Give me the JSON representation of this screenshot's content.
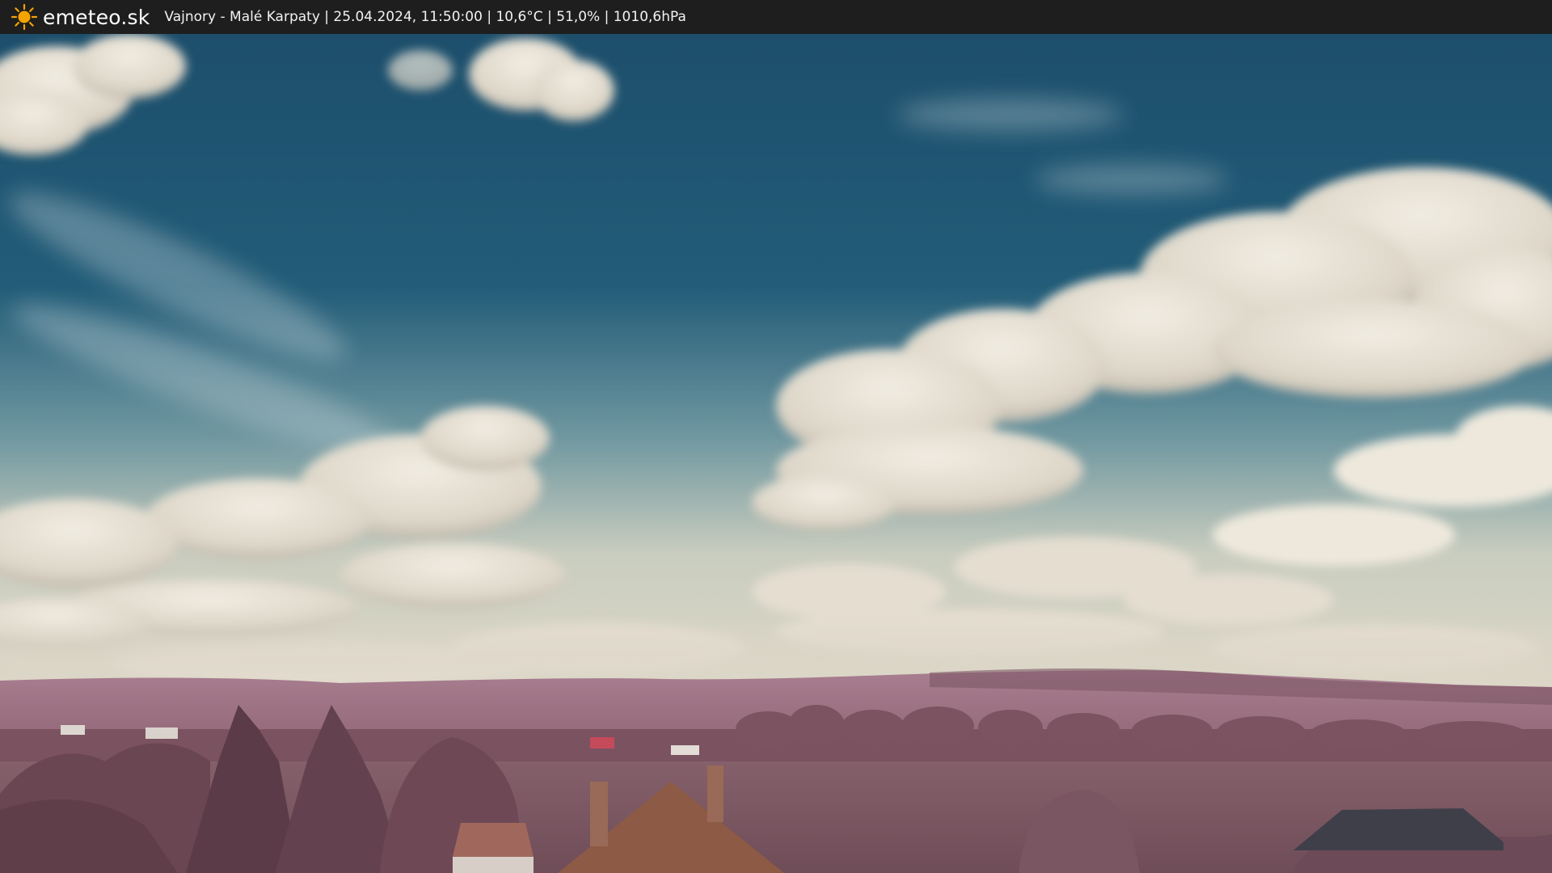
{
  "brand": {
    "name": "emeteo.sk",
    "icon": "sun-icon",
    "icon_color": "#f5a300"
  },
  "caption": {
    "text": "Vajnory - Malé Karpaty | 25.04.2024, 11:50:00 | 10,6°C | 51,0% | 1010,6hPa"
  },
  "scene": {
    "sky_color": "#1f5674",
    "cloud_color": "#e6e1d6",
    "vegetation_color": "#8a5a66"
  }
}
